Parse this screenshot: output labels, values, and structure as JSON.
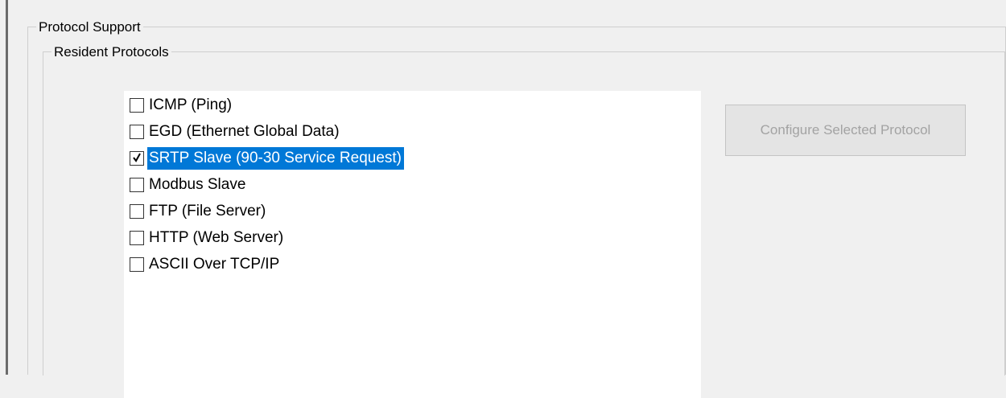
{
  "protocol_support": {
    "legend": "Protocol Support",
    "resident_protocols": {
      "legend": "Resident Protocols",
      "items": [
        {
          "label": "ICMP (Ping)",
          "checked": false,
          "selected": false
        },
        {
          "label": "EGD (Ethernet Global Data)",
          "checked": false,
          "selected": false
        },
        {
          "label": "SRTP Slave (90-30 Service Request)",
          "checked": true,
          "selected": true
        },
        {
          "label": "Modbus Slave",
          "checked": false,
          "selected": false
        },
        {
          "label": "FTP (File Server)",
          "checked": false,
          "selected": false
        },
        {
          "label": "HTTP (Web Server)",
          "checked": false,
          "selected": false
        },
        {
          "label": "ASCII Over TCP/IP",
          "checked": false,
          "selected": false
        }
      ]
    },
    "configure_button": {
      "label": "Configure Selected Protocol",
      "enabled": false
    }
  },
  "colors": {
    "selection_highlight": "#0078d7",
    "window_background": "#f0f0f0",
    "disabled_text": "#a3a3a3"
  }
}
